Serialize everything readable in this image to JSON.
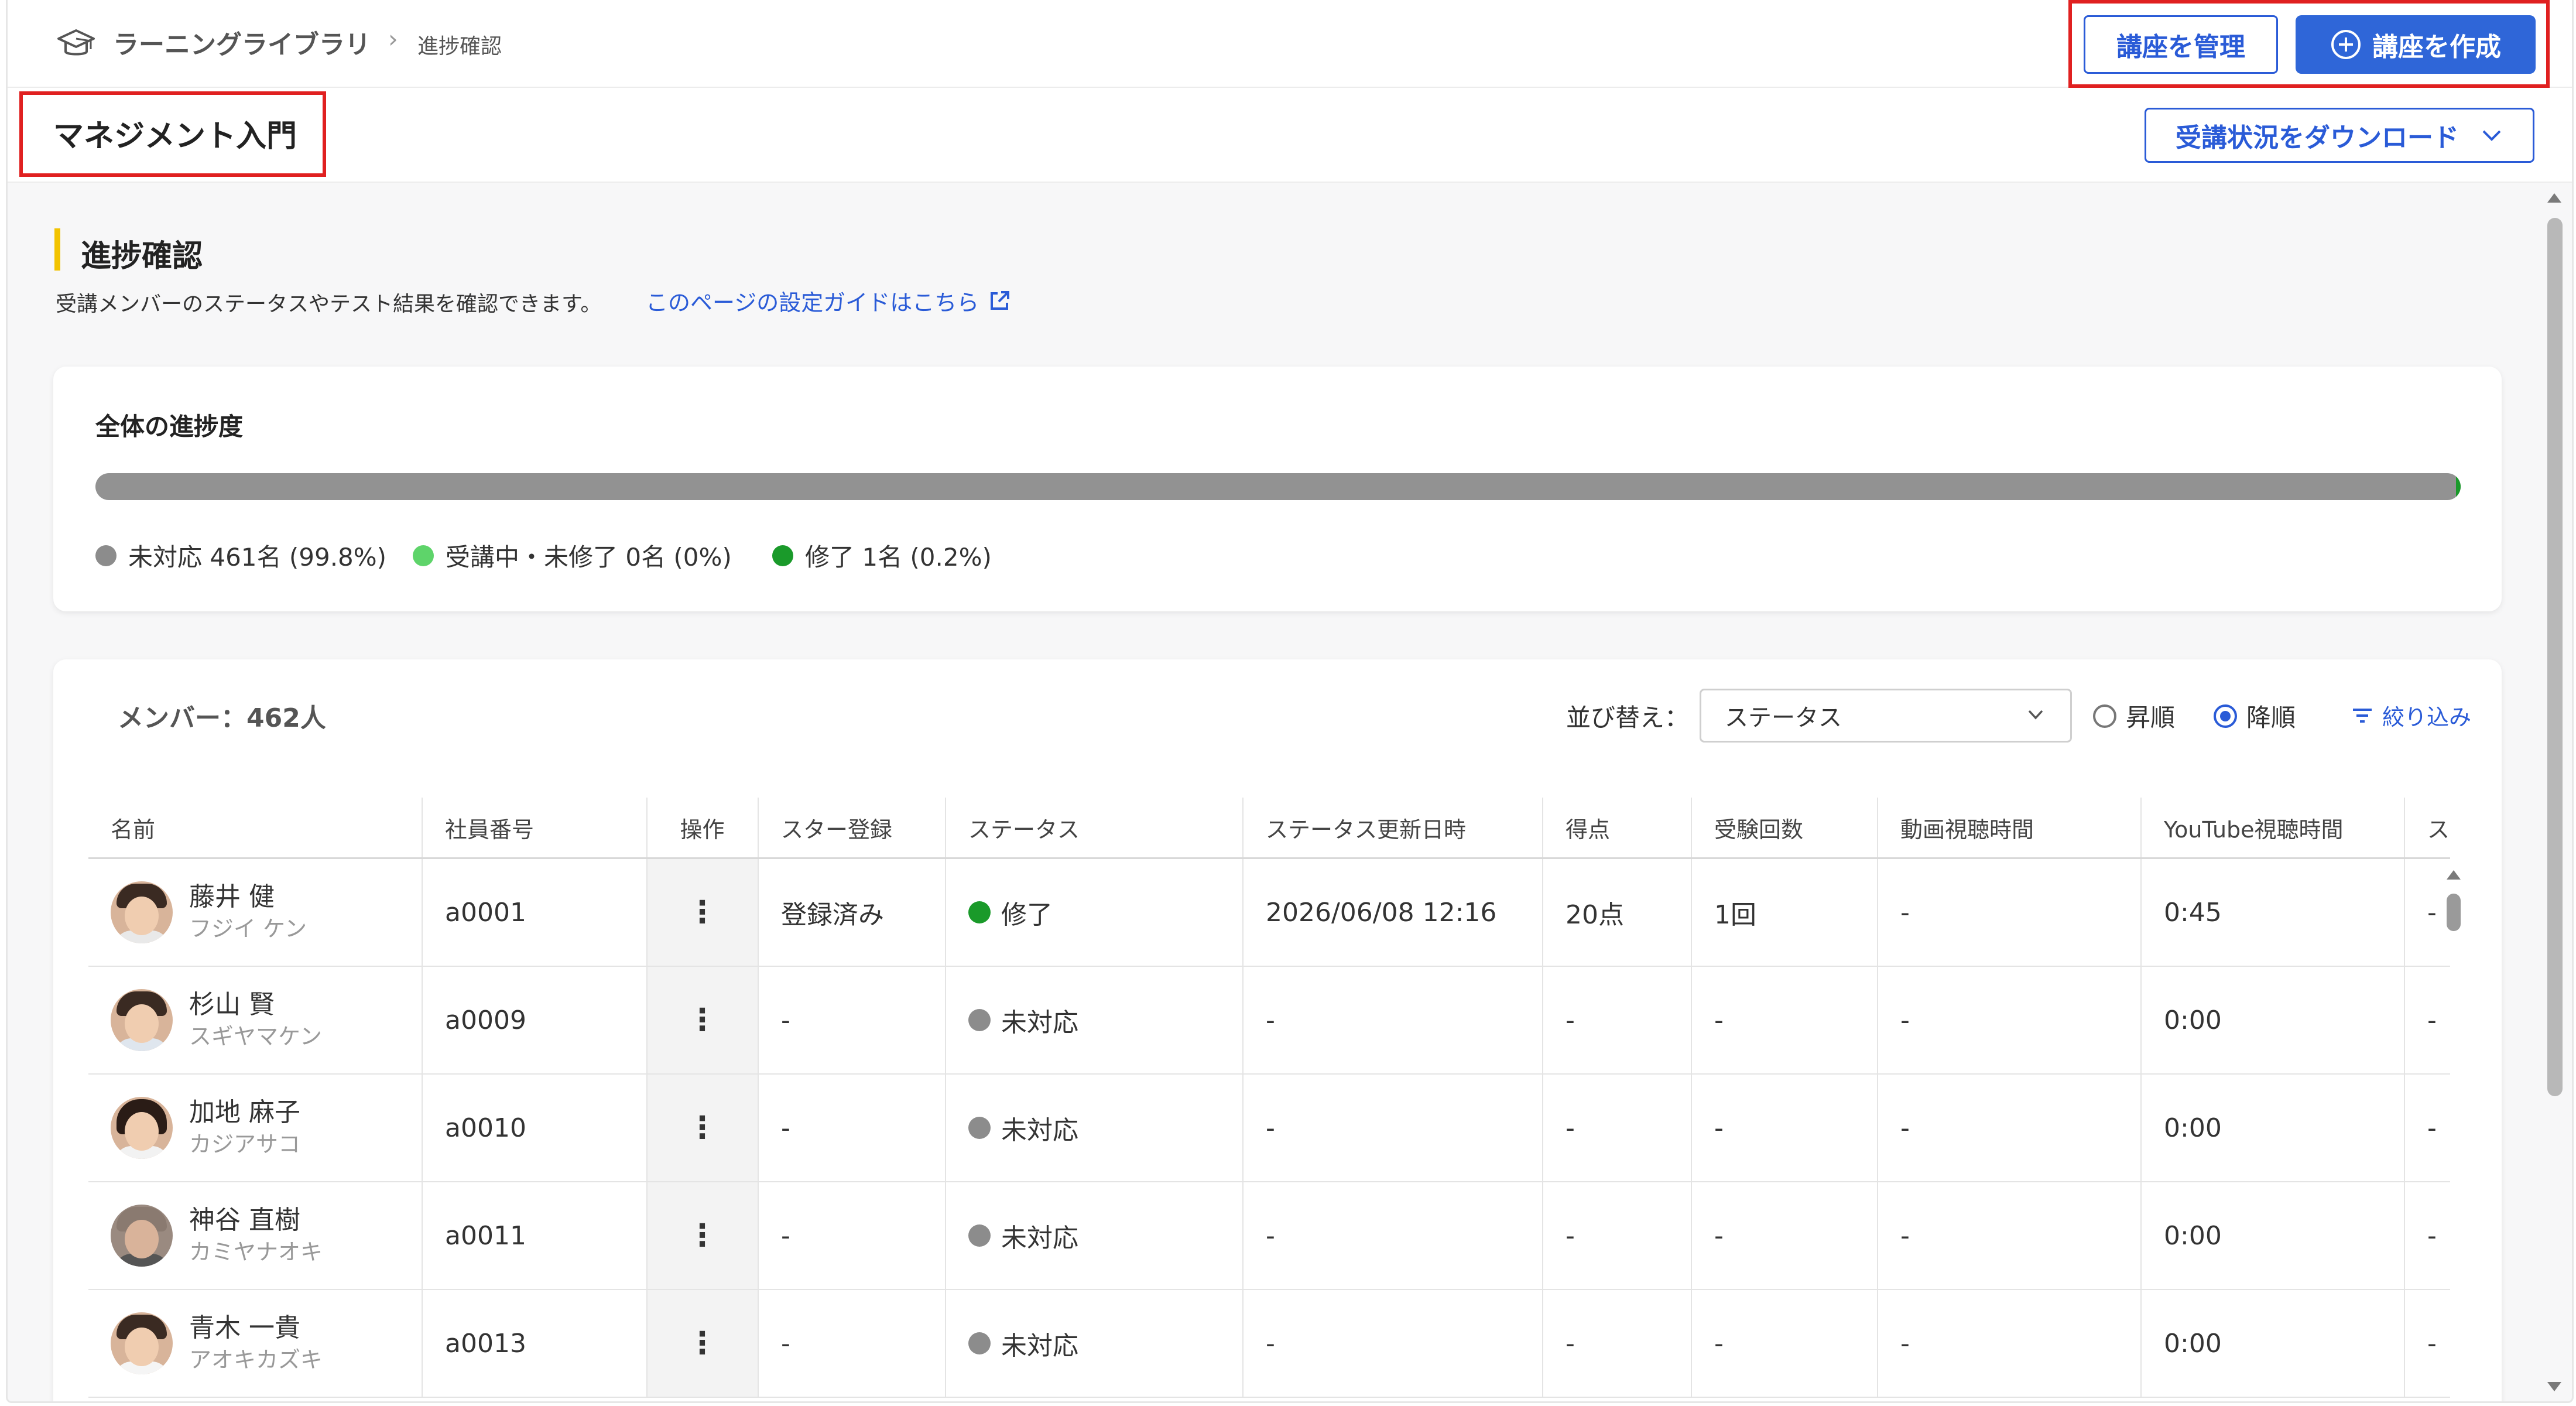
{
  "breadcrumb": {
    "home": "ラーニングライブラリ",
    "separator": "›",
    "current": "進捗確認"
  },
  "header_buttons": {
    "manage": "講座を管理",
    "create": "講座を作成"
  },
  "course": {
    "title": "マネジメント入門",
    "download_label": "受講状況をダウンロード"
  },
  "section": {
    "title": "進捗確認",
    "description": "受講メンバーのステータスやテスト結果を確認できます。",
    "guide_link": "このページの設定ガイドはこちら"
  },
  "progress": {
    "label": "全体の進捗度",
    "completed_fraction": 0.002,
    "legend": [
      {
        "text": "未対応 461名 (99.8%)",
        "color": "#8c8c8c"
      },
      {
        "text": "受講中・未修了 0名 (0%)",
        "color": "#5ed46a"
      },
      {
        "text": "修了 1名 (0.2%)",
        "color": "#1a9a2a"
      }
    ]
  },
  "members": {
    "count_label": "メンバー：462人",
    "sort_label": "並び替え：",
    "sort_value": "ステータス",
    "order_asc": "昇順",
    "order_desc": "降順",
    "order_selected": "desc",
    "filter_label": "絞り込み",
    "columns": [
      "名前",
      "社員番号",
      "操作",
      "スター登録",
      "ステータス",
      "ステータス更新日時",
      "得点",
      "受験回数",
      "動画視聴時間",
      "YouTube視聴時間",
      "ス"
    ],
    "rows": [
      {
        "name": "藤井 健",
        "kana": "フジイ ケン",
        "id": "a0001",
        "op": "⋮",
        "star": "登録済み",
        "status": "修了",
        "status_color": "#1a9a2a",
        "updated": "2026/06/08 12:16",
        "score": "20点",
        "attempts": "1回",
        "video": "-",
        "youtube": "0:45",
        "extra": "-"
      },
      {
        "name": "杉山 賢",
        "kana": "スギヤマケン",
        "id": "a0009",
        "op": "⋮",
        "star": "-",
        "status": "未対応",
        "status_color": "#8c8c8c",
        "updated": "-",
        "score": "-",
        "attempts": "-",
        "video": "-",
        "youtube": "0:00",
        "extra": "-"
      },
      {
        "name": "加地 麻子",
        "kana": "カジアサコ",
        "id": "a0010",
        "op": "⋮",
        "star": "-",
        "status": "未対応",
        "status_color": "#8c8c8c",
        "updated": "-",
        "score": "-",
        "attempts": "-",
        "video": "-",
        "youtube": "0:00",
        "extra": "-"
      },
      {
        "name": "神谷 直樹",
        "kana": "カミヤナオキ",
        "id": "a0011",
        "op": "⋮",
        "star": "-",
        "status": "未対応",
        "status_color": "#8c8c8c",
        "updated": "-",
        "score": "-",
        "attempts": "-",
        "video": "-",
        "youtube": "0:00",
        "extra": "-"
      },
      {
        "name": "青木 一貴",
        "kana": "アオキカズキ",
        "id": "a0013",
        "op": "⋮",
        "star": "-",
        "status": "未対応",
        "status_color": "#8c8c8c",
        "updated": "-",
        "score": "-",
        "attempts": "-",
        "video": "-",
        "youtube": "0:00",
        "extra": "-"
      }
    ]
  },
  "icons": {
    "logo": "graduation-cap-icon",
    "create": "plus-circle-icon",
    "download_chevron": "chevron-down-icon",
    "external": "external-link-icon",
    "filter": "filter-icon"
  },
  "colors": {
    "accent": "#2f66d8",
    "highlight": "#e02020",
    "section_marker": "#f2c300",
    "progress_track": "#929292"
  }
}
